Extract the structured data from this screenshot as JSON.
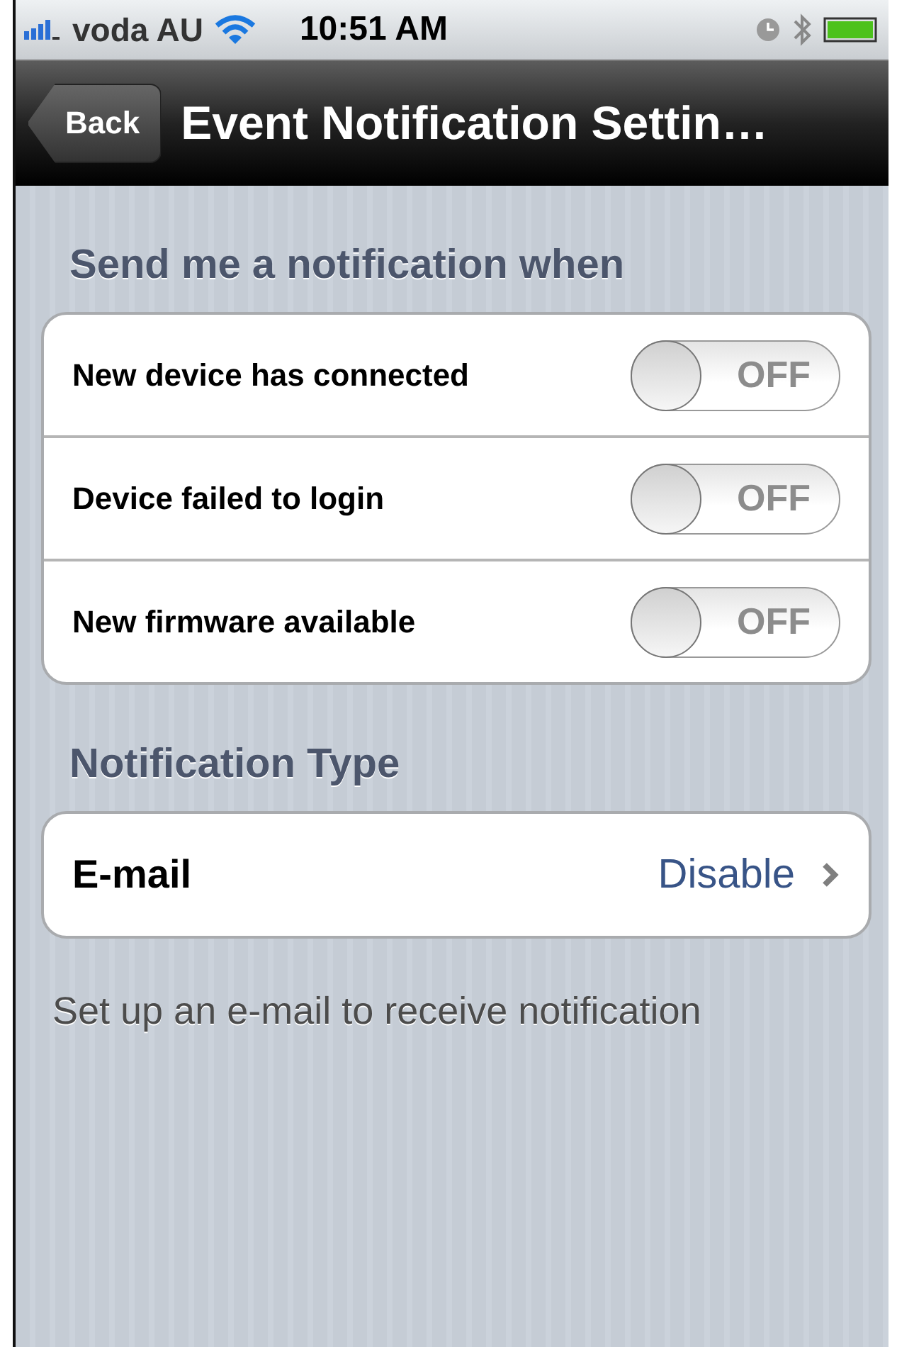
{
  "status_bar": {
    "carrier": "voda AU",
    "time": "10:51 AM"
  },
  "nav_bar": {
    "back": "Back",
    "title": "Event Notification Settin…"
  },
  "sections": [
    {
      "header": "Send me a notification when",
      "rows": [
        {
          "kind": "toggle",
          "label": "New device has connected",
          "on": false,
          "state_text": "OFF"
        },
        {
          "kind": "toggle",
          "label": "Device failed to login",
          "on": false,
          "state_text": "OFF"
        },
        {
          "kind": "toggle",
          "label": "New firmware available",
          "on": false,
          "state_text": "OFF"
        }
      ]
    },
    {
      "header": "Notification Type",
      "rows": [
        {
          "kind": "link",
          "label": "E-mail",
          "value": "Disable"
        }
      ],
      "footer": "Set up an e-mail to receive notification"
    }
  ]
}
